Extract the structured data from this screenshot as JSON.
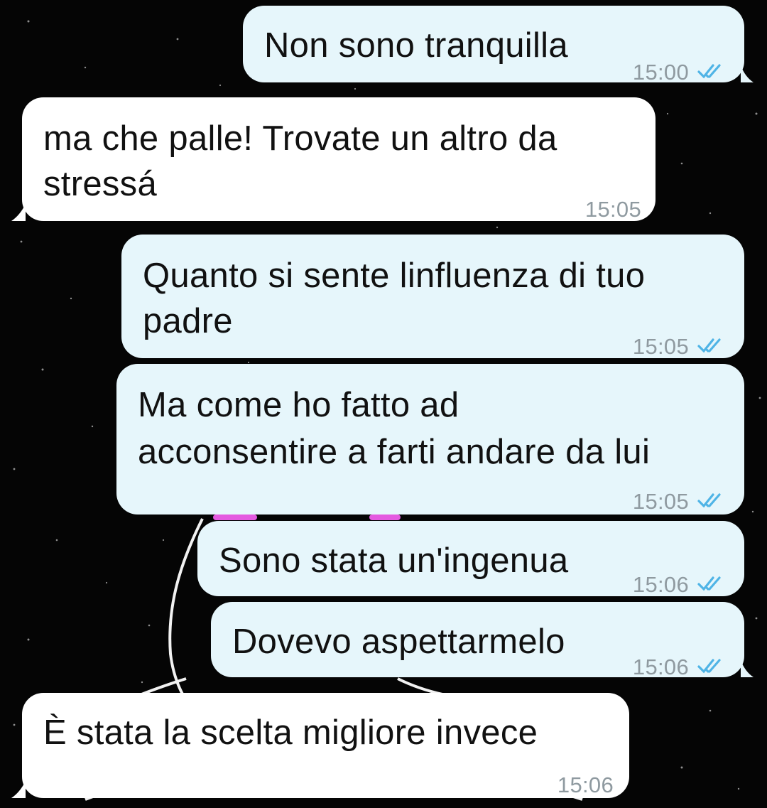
{
  "chat": {
    "messages": [
      {
        "direction": "outgoing",
        "lines": [
          "Non sono tranquilla"
        ],
        "time": "15:00",
        "status_icon": "double-check-icon"
      },
      {
        "direction": "incoming",
        "lines": [
          "ma che palle! Trovate un altro da",
          "stressá"
        ],
        "time": "15:05"
      },
      {
        "direction": "outgoing",
        "lines": [
          "Quanto si sente linfluenza di tuo",
          "padre"
        ],
        "time": "15:05",
        "status_icon": "double-check-icon"
      },
      {
        "direction": "outgoing",
        "lines": [
          "Ma come ho fatto ad",
          "acconsentire a farti andare da lui"
        ],
        "time": "15:05",
        "status_icon": "double-check-icon"
      },
      {
        "direction": "outgoing",
        "lines": [
          "Sono stata un'ingenua"
        ],
        "time": "15:06",
        "status_icon": "double-check-icon"
      },
      {
        "direction": "outgoing",
        "lines": [
          "Dovevo aspettarmelo"
        ],
        "time": "15:06",
        "status_icon": "double-check-icon"
      },
      {
        "direction": "incoming",
        "lines": [
          "È stata la scelta migliore invece"
        ],
        "time": "15:06"
      }
    ]
  },
  "colors": {
    "outgoing_bubble": "#e6f6fb",
    "incoming_bubble": "#ffffff",
    "read_ticks": "#4fb4e6",
    "wallpaper": "#050505"
  }
}
